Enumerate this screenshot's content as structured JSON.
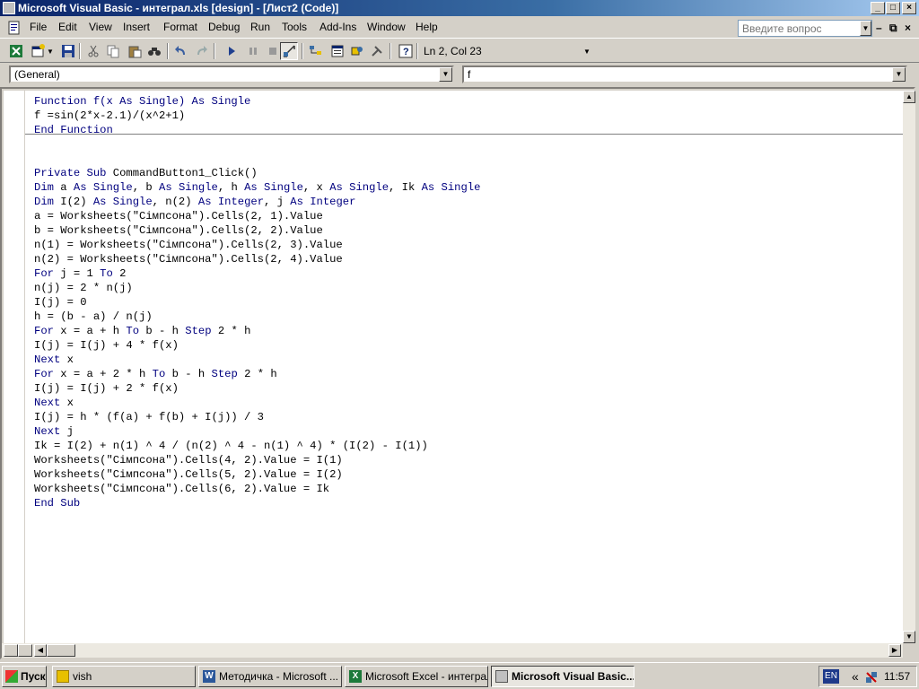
{
  "window": {
    "title": "Microsoft Visual Basic - интеграл.xls [design] - [Лист2 (Code)]"
  },
  "menu": {
    "items": [
      "File",
      "Edit",
      "View",
      "Insert",
      "Format",
      "Debug",
      "Run",
      "Tools",
      "Add-Ins",
      "Window",
      "Help"
    ],
    "help_placeholder": "Введите вопрос"
  },
  "toolbar": {
    "position": "Ln 2, Col 23"
  },
  "combos": {
    "object": "(General)",
    "procedure": "f"
  },
  "code": {
    "lines": [
      [
        {
          "t": "Function f(x ",
          "k": true
        },
        {
          "t": "As Single) ",
          "k": true
        },
        {
          "t": "As Single",
          "k": true
        }
      ],
      [
        {
          "t": "f =sin(2*x-2.1)/(x^2+1)",
          "k": false
        }
      ],
      [
        {
          "t": "End Function",
          "k": true
        }
      ],
      [],
      [],
      [
        {
          "t": "Private Sub ",
          "k": true
        },
        {
          "t": "CommandButton1_Click()",
          "k": false
        }
      ],
      [
        {
          "t": "Dim ",
          "k": true
        },
        {
          "t": "a ",
          "k": false
        },
        {
          "t": "As Single",
          "k": true
        },
        {
          "t": ", b ",
          "k": false
        },
        {
          "t": "As Single",
          "k": true
        },
        {
          "t": ", h ",
          "k": false
        },
        {
          "t": "As Single",
          "k": true
        },
        {
          "t": ", x ",
          "k": false
        },
        {
          "t": "As Single",
          "k": true
        },
        {
          "t": ", Ik ",
          "k": false
        },
        {
          "t": "As Single",
          "k": true
        }
      ],
      [
        {
          "t": "Dim ",
          "k": true
        },
        {
          "t": "I(2) ",
          "k": false
        },
        {
          "t": "As Single",
          "k": true
        },
        {
          "t": ", n(2) ",
          "k": false
        },
        {
          "t": "As Integer",
          "k": true
        },
        {
          "t": ", j ",
          "k": false
        },
        {
          "t": "As Integer",
          "k": true
        }
      ],
      [
        {
          "t": "a = Worksheets(\"Сімпсона\").Cells(2, 1).Value",
          "k": false
        }
      ],
      [
        {
          "t": "b = Worksheets(\"Сімпсона\").Cells(2, 2).Value",
          "k": false
        }
      ],
      [
        {
          "t": "n(1) = Worksheets(\"Сімпсона\").Cells(2, 3).Value",
          "k": false
        }
      ],
      [
        {
          "t": "n(2) = Worksheets(\"Сімпсона\").Cells(2, 4).Value",
          "k": false
        }
      ],
      [
        {
          "t": "For ",
          "k": true
        },
        {
          "t": "j = 1 ",
          "k": false
        },
        {
          "t": "To ",
          "k": true
        },
        {
          "t": "2",
          "k": false
        }
      ],
      [
        {
          "t": "n(j) = 2 * n(j)",
          "k": false
        }
      ],
      [
        {
          "t": "I(j) = 0",
          "k": false
        }
      ],
      [
        {
          "t": "h = (b - a) / n(j)",
          "k": false
        }
      ],
      [
        {
          "t": "For ",
          "k": true
        },
        {
          "t": "x = a + h ",
          "k": false
        },
        {
          "t": "To ",
          "k": true
        },
        {
          "t": "b - h ",
          "k": false
        },
        {
          "t": "Step ",
          "k": true
        },
        {
          "t": "2 * h",
          "k": false
        }
      ],
      [
        {
          "t": "I(j) = I(j) + 4 * f(x)",
          "k": false
        }
      ],
      [
        {
          "t": "Next ",
          "k": true
        },
        {
          "t": "x",
          "k": false
        }
      ],
      [
        {
          "t": "For ",
          "k": true
        },
        {
          "t": "x = a + 2 * h ",
          "k": false
        },
        {
          "t": "To ",
          "k": true
        },
        {
          "t": "b - h ",
          "k": false
        },
        {
          "t": "Step ",
          "k": true
        },
        {
          "t": "2 * h",
          "k": false
        }
      ],
      [
        {
          "t": "I(j) = I(j) + 2 * f(x)",
          "k": false
        }
      ],
      [
        {
          "t": "Next ",
          "k": true
        },
        {
          "t": "x",
          "k": false
        }
      ],
      [
        {
          "t": "I(j) = h * (f(a) + f(b) + I(j)) / 3",
          "k": false
        }
      ],
      [
        {
          "t": "Next ",
          "k": true
        },
        {
          "t": "j",
          "k": false
        }
      ],
      [
        {
          "t": "Ik = I(2) + n(1) ^ 4 / (n(2) ^ 4 - n(1) ^ 4) * (I(2) - I(1))",
          "k": false
        }
      ],
      [
        {
          "t": "Worksheets(\"Сімпсона\").Cells(4, 2).Value = I(1)",
          "k": false
        }
      ],
      [
        {
          "t": "Worksheets(\"Сімпсона\").Cells(5, 2).Value = I(2)",
          "k": false
        }
      ],
      [
        {
          "t": "Worksheets(\"Сімпсона\").Cells(6, 2).Value = Ik",
          "k": false
        }
      ],
      [
        {
          "t": "End Sub",
          "k": true
        }
      ]
    ]
  },
  "taskbar": {
    "start_label": "Пуск",
    "tasks": [
      {
        "label": "vish",
        "icon": "folder-icon"
      },
      {
        "label": "Методичка - Microsoft ...",
        "icon": "word-icon"
      },
      {
        "label": "Microsoft Excel - интеграл",
        "icon": "excel-icon"
      },
      {
        "label": "Microsoft Visual Basic...",
        "icon": "vba-icon"
      }
    ],
    "language": "EN",
    "chevron": "«",
    "clock": "11:57"
  }
}
